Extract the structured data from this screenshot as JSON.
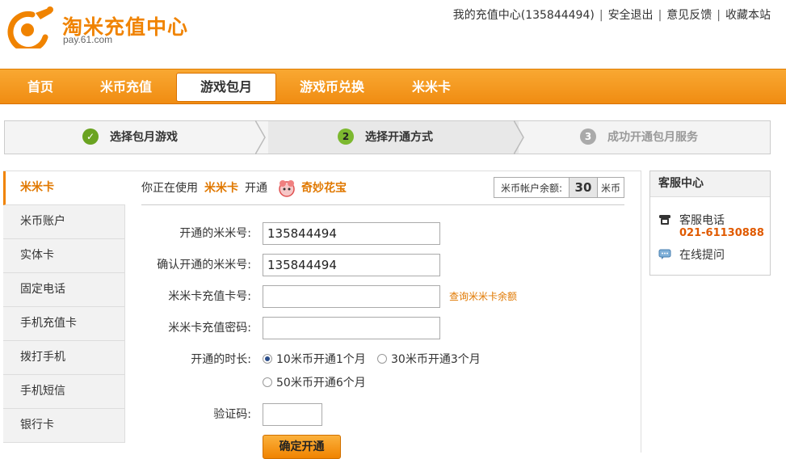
{
  "header": {
    "logo_title": "淘米充值中心",
    "logo_sub": "pay.61.com",
    "top_links": {
      "my_center": "我的充值中心(135844494)",
      "logout": "安全退出",
      "feedback": "意见反馈",
      "bookmark": "收藏本站",
      "separator": "|"
    }
  },
  "nav": {
    "items": [
      {
        "label": "首页"
      },
      {
        "label": "米币充值"
      },
      {
        "label": "游戏包月",
        "active": true
      },
      {
        "label": "游戏币兑换"
      },
      {
        "label": "米米卡"
      }
    ]
  },
  "steps": [
    {
      "icon": "✓",
      "label": "选择包月游戏",
      "state": "done"
    },
    {
      "icon": "2",
      "label": "选择开通方式",
      "state": "current"
    },
    {
      "icon": "3",
      "label": "成功开通包月服务",
      "state": "pending"
    }
  ],
  "sidebar": {
    "items": [
      {
        "label": "米米卡",
        "active": true
      },
      {
        "label": "米币账户"
      },
      {
        "label": "实体卡"
      },
      {
        "label": "固定电话"
      },
      {
        "label": "手机充值卡"
      },
      {
        "label": "拨打手机"
      },
      {
        "label": "手机短信"
      },
      {
        "label": "银行卡"
      }
    ]
  },
  "main": {
    "usage_prefix": "你正在使用",
    "method": "米米卡",
    "open_text": "开通",
    "game_name": "奇妙花宝",
    "balance_label": "米币帐户余额:",
    "balance_value": "30",
    "balance_unit": "米币",
    "form": {
      "mimi_id_label": "开通的米米号:",
      "mimi_id_value": "135844494",
      "confirm_id_label": "确认开通的米米号:",
      "confirm_id_value": "135844494",
      "card_no_label": "米米卡充值卡号:",
      "card_no_value": "",
      "query_link": "查询米米卡余额",
      "card_pwd_label": "米米卡充值密码:",
      "card_pwd_value": "",
      "duration_label": "开通的时长:",
      "options": [
        {
          "label": "10米币开通1个月",
          "selected": true
        },
        {
          "label": "30米币开通3个月",
          "selected": false
        },
        {
          "label": "50米币开通6个月",
          "selected": false
        }
      ],
      "captcha_label": "验证码:",
      "captcha_value": "",
      "submit_label": "确定开通"
    }
  },
  "service": {
    "title": "客服中心",
    "phone_label": "客服电话",
    "phone_number": "021-61130888",
    "online_label": "在线提问"
  },
  "colors": {
    "brand_orange": "#f08300",
    "nav_gradient_top": "#f9a832",
    "step_done_green": "#6aa321",
    "step_current_green": "#7cb82f",
    "step_pending_gray": "#999999"
  }
}
